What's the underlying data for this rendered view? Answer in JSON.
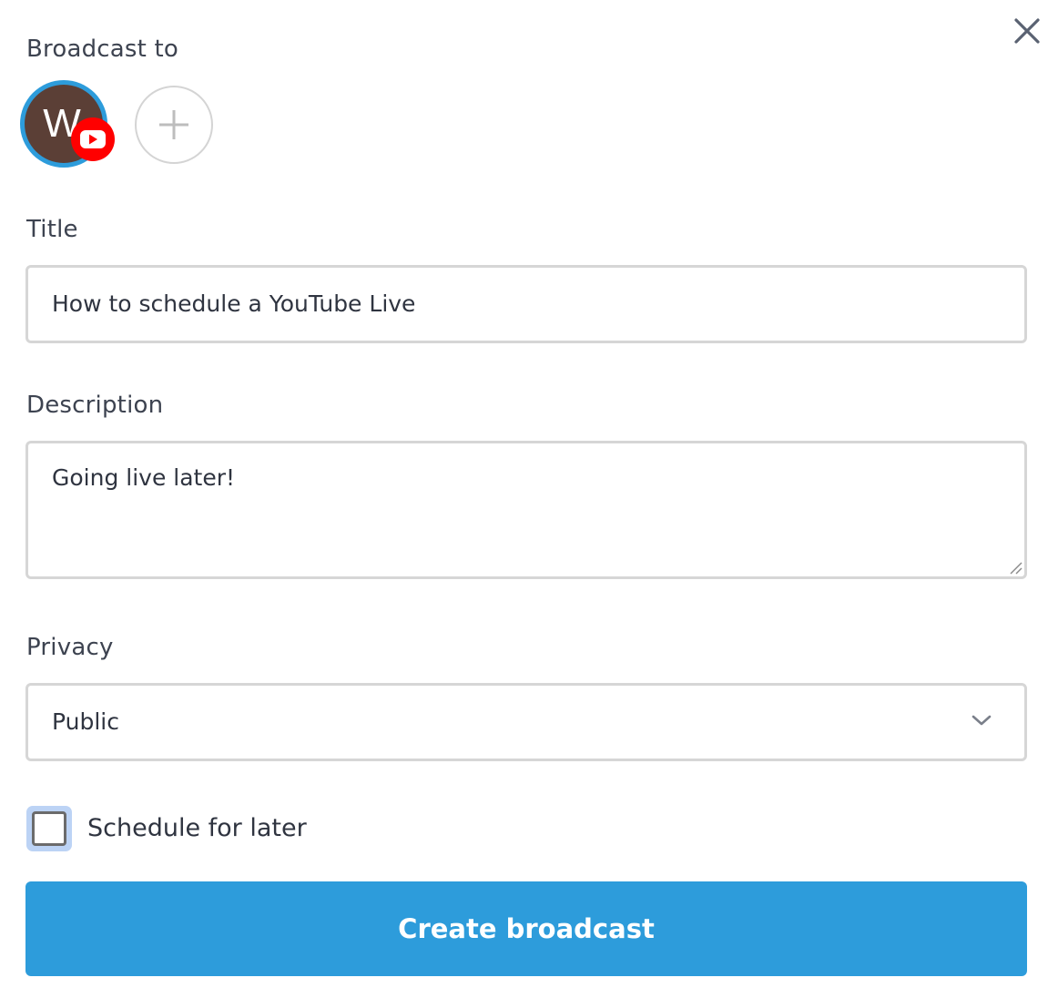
{
  "dialog": {
    "close_icon": "close-icon"
  },
  "broadcast_to": {
    "label": "Broadcast to",
    "account": {
      "initial": "W",
      "avatar_color": "#5b3f36",
      "ring_color": "#2d9cdb",
      "platform_icon": "youtube-icon",
      "selected": true
    },
    "add_icon": "plus-icon"
  },
  "title": {
    "label": "Title",
    "value": "How to schedule a YouTube Live"
  },
  "description": {
    "label": "Description",
    "value": "Going live later!"
  },
  "privacy": {
    "label": "Privacy",
    "selected": "Public",
    "dropdown_icon": "chevron-down-icon"
  },
  "schedule": {
    "label": "Schedule for later",
    "checked": false
  },
  "submit": {
    "label": "Create broadcast",
    "color": "#2d9cdb"
  },
  "colors": {
    "accent": "#2d9cdb",
    "youtube": "#ff0000",
    "text": "#3d4350",
    "border": "#d6d6d6"
  }
}
